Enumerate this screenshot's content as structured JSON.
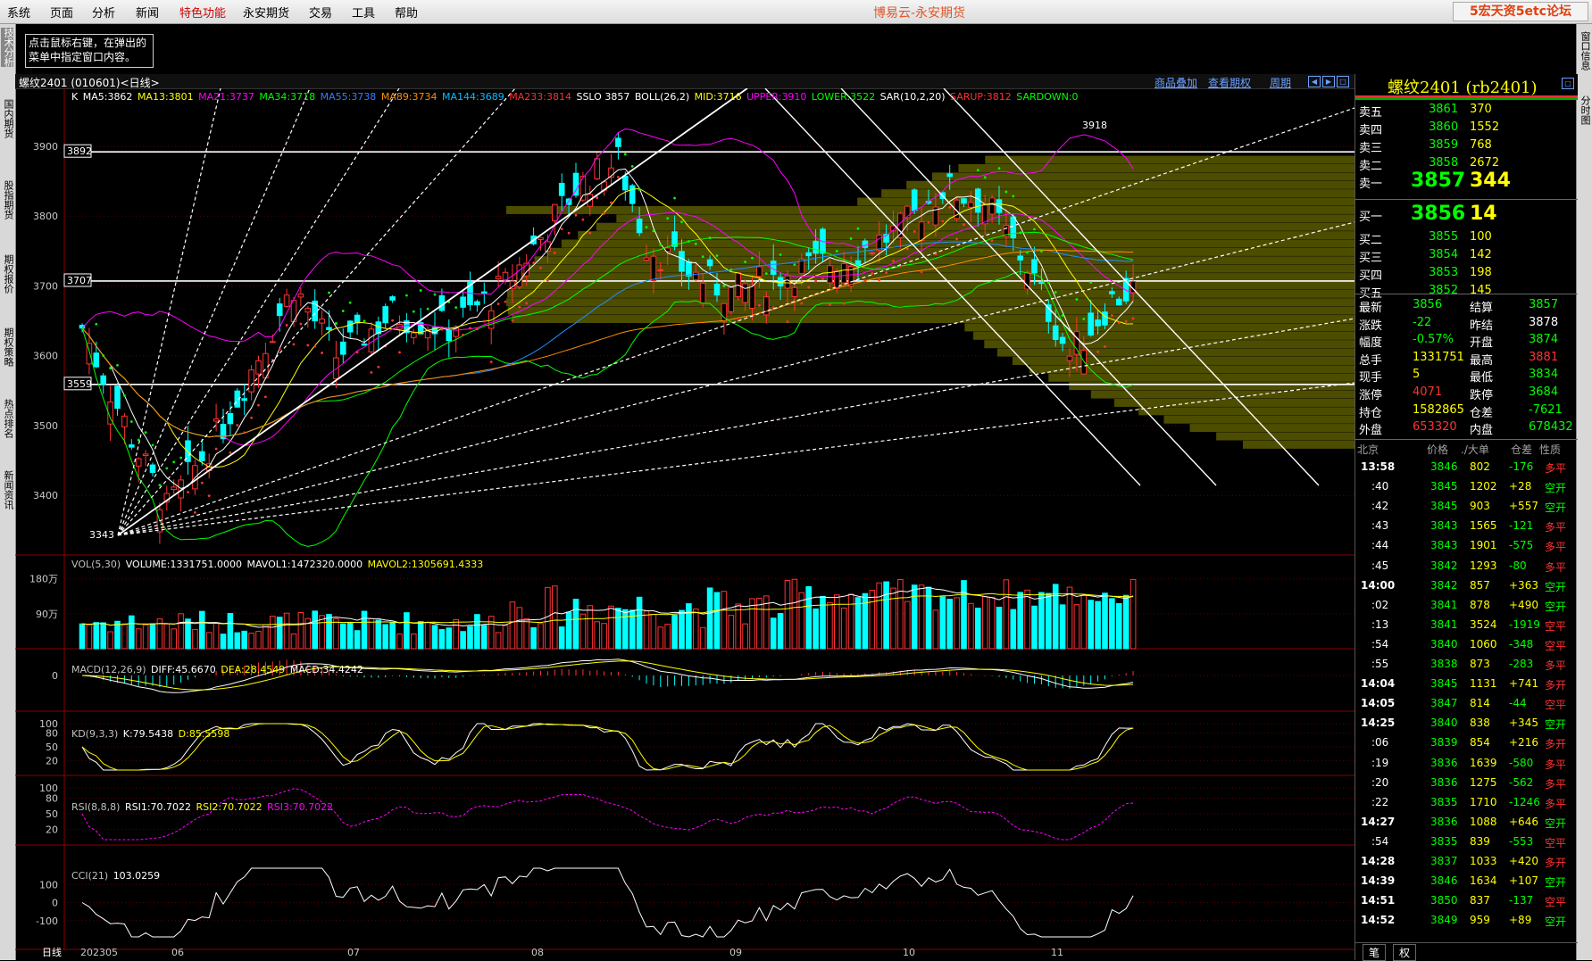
{
  "menu": {
    "items": [
      "系统",
      "页面",
      "分析",
      "新闻",
      "特色功能",
      "永安期货",
      "交易",
      "工具",
      "帮助"
    ],
    "highlight_index": 4,
    "window_title": "博易云-永安期货",
    "watermark": "5宏天资5etc论坛"
  },
  "left_tabs": [
    "技术分析",
    "国内期货",
    "股指期货",
    "期权报价",
    "期权策略",
    "热点排名",
    "新闻资讯"
  ],
  "right_tabs": [
    "窗口信息",
    "分时图"
  ],
  "tip": "点击鼠标右键，在弹出的菜单中指定窗口内容。",
  "chart_header": {
    "symbol_label": "螺纹2401 (010601)<日线>",
    "links": [
      "商品叠加",
      "查看期权",
      "周期"
    ]
  },
  "colors": {
    "up": "#ff3333",
    "down": "#00ffff",
    "ma5": "#ffffff",
    "ma13": "#ffff00",
    "ma21": "#ff00ff",
    "ma34": "#00ff00",
    "ma55": "#1e90ff",
    "ma89": "#ff8c00",
    "ma144": "#00bfff",
    "ma233": "#ff3030",
    "boll": "#ffff00",
    "upper": "#ff00ff",
    "lower": "#00ff00"
  },
  "main_indicators": [
    {
      "text": "K",
      "color": "#ffffff"
    },
    {
      "text": "MA5:3862",
      "color": "#ffffff"
    },
    {
      "text": "MA13:3801",
      "color": "#ffff00"
    },
    {
      "text": "MA21:3737",
      "color": "#ff00ff"
    },
    {
      "text": "MA34:3718",
      "color": "#00ff00"
    },
    {
      "text": "MA55:3738",
      "color": "#3a7bff"
    },
    {
      "text": "MA89:3734",
      "color": "#ff8c00"
    },
    {
      "text": "MA144:3689",
      "color": "#00bfff"
    },
    {
      "text": "MA233:3814",
      "color": "#ff3030"
    },
    {
      "text": "SSLO 3857",
      "color": "#ffffff"
    },
    {
      "text": "BOLL(26,2)",
      "color": "#ffffff"
    },
    {
      "text": "MID:3716",
      "color": "#ffff00"
    },
    {
      "text": "UPPER:3910",
      "color": "#ff00ff"
    },
    {
      "text": "LOWER:3522",
      "color": "#00ff00"
    },
    {
      "text": "SAR(10,2,20)",
      "color": "#ffffff"
    },
    {
      "text": "SARUP:3812",
      "color": "#ff3030"
    },
    {
      "text": "SARDOWN:0",
      "color": "#00ff00"
    }
  ],
  "price_axis": [
    "3900",
    "3800",
    "3700",
    "3600",
    "3500",
    "3400"
  ],
  "price_boxes": [
    "3892",
    "3707",
    "3559"
  ],
  "price_marks": {
    "high": "3918",
    "low": "3343"
  },
  "volume_header": [
    {
      "text": "VOL(5,30)",
      "color": "#c0c0c0"
    },
    {
      "text": "VOLUME:1331751.0000",
      "color": "#ffffff"
    },
    {
      "text": "MAVOL1:1472320.0000",
      "color": "#ffffff"
    },
    {
      "text": "MAVOL2:1305691.4333",
      "color": "#ffff00"
    }
  ],
  "volume_axis": [
    "180万",
    "90万"
  ],
  "macd_header": [
    {
      "text": "MACD(12,26,9)",
      "color": "#c0c0c0"
    },
    {
      "text": "DIFF:45.6670",
      "color": "#ffffff"
    },
    {
      "text": "DEA:28.4549",
      "color": "#ffff00"
    },
    {
      "text": "MACD:34.4242",
      "color": "#ffffff"
    }
  ],
  "macd_axis": [
    "0"
  ],
  "kd_header": [
    {
      "text": "KD(9,3,3)",
      "color": "#c0c0c0"
    },
    {
      "text": "K:79.5438",
      "color": "#ffffff"
    },
    {
      "text": "D:85.5598",
      "color": "#ffff00"
    }
  ],
  "kd_axis": [
    "100",
    "80",
    "50",
    "20"
  ],
  "rsi_header": [
    {
      "text": "RSI(8,8,8)",
      "color": "#c0c0c0"
    },
    {
      "text": "RSI1:70.7022",
      "color": "#ffffff"
    },
    {
      "text": "RSI2:70.7022",
      "color": "#ffff00"
    },
    {
      "text": "RSI3:70.7022",
      "color": "#ff00ff"
    }
  ],
  "rsi_axis": [
    "100",
    "80",
    "50",
    "20"
  ],
  "cci_header": [
    {
      "text": "CCI(21)",
      "color": "#c0c0c0"
    },
    {
      "text": "103.0259",
      "color": "#ffffff"
    }
  ],
  "cci_axis": [
    "100",
    "0",
    "-100"
  ],
  "date_axis": [
    "日线",
    "202305",
    "06",
    "07",
    "08",
    "09",
    "10",
    "11"
  ],
  "quote": {
    "title": "螺纹2401 (rb2401)",
    "asks": [
      {
        "label": "卖五",
        "price": "3861",
        "vol": "370"
      },
      {
        "label": "卖四",
        "price": "3860",
        "vol": "1552"
      },
      {
        "label": "卖三",
        "price": "3859",
        "vol": "768"
      },
      {
        "label": "卖二",
        "price": "3858",
        "vol": "2672"
      },
      {
        "label": "卖一",
        "price": "3857",
        "vol": "344"
      }
    ],
    "bids": [
      {
        "label": "买一",
        "price": "3856",
        "vol": "14"
      },
      {
        "label": "买二",
        "price": "3855",
        "vol": "100"
      },
      {
        "label": "买三",
        "price": "3854",
        "vol": "142"
      },
      {
        "label": "买四",
        "price": "3853",
        "vol": "198"
      },
      {
        "label": "买五",
        "price": "3852",
        "vol": "145"
      }
    ],
    "stats": [
      {
        "l1": "最新",
        "v1": "3856",
        "c1": "#00ff00",
        "l2": "结算",
        "v2": "3857",
        "c2": "#00ff00"
      },
      {
        "l1": "涨跌",
        "v1": "-22",
        "c1": "#00ff00",
        "l2": "昨结",
        "v2": "3878",
        "c2": "#ffffff"
      },
      {
        "l1": "幅度",
        "v1": "-0.57%",
        "c1": "#00ff00",
        "l2": "开盘",
        "v2": "3874",
        "c2": "#00ff00"
      },
      {
        "l1": "总手",
        "v1": "1331751",
        "c1": "#ffff00",
        "l2": "最高",
        "v2": "3881",
        "c2": "#ff3333"
      },
      {
        "l1": "现手",
        "v1": "5",
        "c1": "#ffff00",
        "l2": "最低",
        "v2": "3834",
        "c2": "#00ff00"
      },
      {
        "l1": "涨停",
        "v1": "4071",
        "c1": "#ff3333",
        "l2": "跌停",
        "v2": "3684",
        "c2": "#00ff00"
      },
      {
        "l1": "持仓",
        "v1": "1582865",
        "c1": "#ffff00",
        "l2": "仓差",
        "v2": "-7621",
        "c2": "#00ff00"
      },
      {
        "l1": "外盘",
        "v1": "653320",
        "c1": "#ff3333",
        "l2": "内盘",
        "v2": "678432",
        "c2": "#00ff00"
      }
    ],
    "ticks_header": [
      "北京",
      "价格",
      "./大单",
      "仓差",
      "性质"
    ],
    "ticks": [
      {
        "t": "13:58",
        "p": "3846",
        "v": "802",
        "d": "-176",
        "n": "多平",
        "pc": "#00ff00",
        "dc": "#00ff00",
        "nc": "#ff3333"
      },
      {
        "t": ":40",
        "p": "3845",
        "v": "1202",
        "d": "+28",
        "n": "空开",
        "pc": "#00ff00",
        "dc": "#ffff00",
        "nc": "#00ff00"
      },
      {
        "t": ":42",
        "p": "3845",
        "v": "903",
        "d": "+557",
        "n": "空开",
        "pc": "#00ff00",
        "dc": "#ffff00",
        "nc": "#00ff00"
      },
      {
        "t": ":43",
        "p": "3843",
        "v": "1565",
        "d": "-121",
        "n": "多平",
        "pc": "#00ff00",
        "dc": "#00ff00",
        "nc": "#ff3333"
      },
      {
        "t": ":44",
        "p": "3843",
        "v": "1901",
        "d": "-575",
        "n": "多平",
        "pc": "#00ff00",
        "dc": "#00ff00",
        "nc": "#ff3333"
      },
      {
        "t": ":45",
        "p": "3842",
        "v": "1293",
        "d": "-80",
        "n": "多平",
        "pc": "#00ff00",
        "dc": "#00ff00",
        "nc": "#ff3333"
      },
      {
        "t": "14:00",
        "p": "3842",
        "v": "857",
        "d": "+363",
        "n": "空开",
        "pc": "#00ff00",
        "dc": "#ffff00",
        "nc": "#00ff00"
      },
      {
        "t": ":02",
        "p": "3841",
        "v": "878",
        "d": "+490",
        "n": "空开",
        "pc": "#00ff00",
        "dc": "#ffff00",
        "nc": "#00ff00"
      },
      {
        "t": ":13",
        "p": "3841",
        "v": "3524",
        "d": "-1919",
        "n": "空平",
        "pc": "#00ff00",
        "dc": "#00ff00",
        "nc": "#ff3333"
      },
      {
        "t": ":54",
        "p": "3840",
        "v": "1060",
        "d": "-348",
        "n": "空平",
        "pc": "#00ff00",
        "dc": "#00ff00",
        "nc": "#ff3333"
      },
      {
        "t": ":55",
        "p": "3838",
        "v": "873",
        "d": "-283",
        "n": "多平",
        "pc": "#00ff00",
        "dc": "#00ff00",
        "nc": "#ff3333"
      },
      {
        "t": "14:04",
        "p": "3845",
        "v": "1131",
        "d": "+741",
        "n": "多开",
        "pc": "#00ff00",
        "dc": "#ffff00",
        "nc": "#ff3333"
      },
      {
        "t": "14:05",
        "p": "3847",
        "v": "814",
        "d": "-44",
        "n": "空平",
        "pc": "#00ff00",
        "dc": "#00ff00",
        "nc": "#ff3333"
      },
      {
        "t": "14:25",
        "p": "3840",
        "v": "838",
        "d": "+345",
        "n": "空开",
        "pc": "#00ff00",
        "dc": "#ffff00",
        "nc": "#00ff00"
      },
      {
        "t": ":06",
        "p": "3839",
        "v": "854",
        "d": "+216",
        "n": "多开",
        "pc": "#00ff00",
        "dc": "#ffff00",
        "nc": "#ff3333"
      },
      {
        "t": ":19",
        "p": "3836",
        "v": "1639",
        "d": "-580",
        "n": "多平",
        "pc": "#00ff00",
        "dc": "#00ff00",
        "nc": "#ff3333"
      },
      {
        "t": ":20",
        "p": "3836",
        "v": "1275",
        "d": "-562",
        "n": "多平",
        "pc": "#00ff00",
        "dc": "#00ff00",
        "nc": "#ff3333"
      },
      {
        "t": ":22",
        "p": "3835",
        "v": "1710",
        "d": "-1246",
        "n": "多平",
        "pc": "#00ff00",
        "dc": "#00ff00",
        "nc": "#ff3333"
      },
      {
        "t": "14:27",
        "p": "3836",
        "v": "1088",
        "d": "+646",
        "n": "空开",
        "pc": "#00ff00",
        "dc": "#ffff00",
        "nc": "#00ff00"
      },
      {
        "t": ":54",
        "p": "3835",
        "v": "839",
        "d": "-553",
        "n": "空平",
        "pc": "#00ff00",
        "dc": "#00ff00",
        "nc": "#ff3333"
      },
      {
        "t": "14:28",
        "p": "3837",
        "v": "1033",
        "d": "+420",
        "n": "多开",
        "pc": "#00ff00",
        "dc": "#ffff00",
        "nc": "#ff3333"
      },
      {
        "t": "14:39",
        "p": "3846",
        "v": "1634",
        "d": "+107",
        "n": "空开",
        "pc": "#00ff00",
        "dc": "#ffff00",
        "nc": "#00ff00"
      },
      {
        "t": "14:51",
        "p": "3850",
        "v": "837",
        "d": "-137",
        "n": "空平",
        "pc": "#00ff00",
        "dc": "#00ff00",
        "nc": "#ff3333"
      },
      {
        "t": "14:52",
        "p": "3849",
        "v": "959",
        "d": "+89",
        "n": "空开",
        "pc": "#00ff00",
        "dc": "#ffff00",
        "nc": "#00ff00"
      }
    ],
    "bottom_tabs": [
      "笔",
      "权"
    ]
  }
}
